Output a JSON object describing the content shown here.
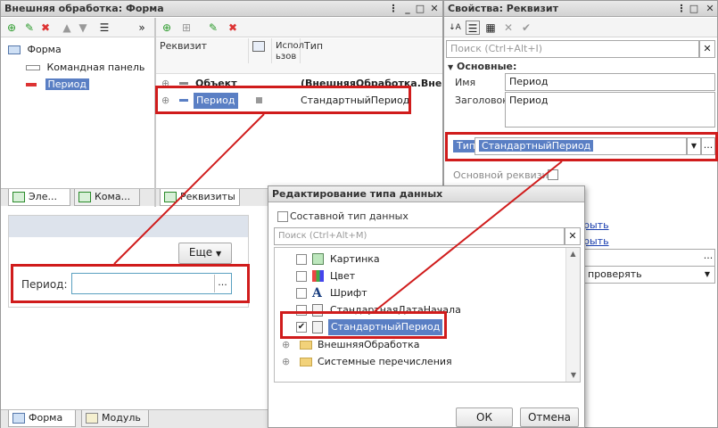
{
  "form_window": {
    "title": "Внешняя обработка: Форма",
    "tree": [
      "Форма",
      "Командная панель",
      "Период"
    ],
    "left_tabs": [
      "Эле...",
      "Кома..."
    ],
    "attr_headers": {
      "rekvizit": "Реквизит",
      "ispol": "Испол ьзов",
      "tip": "Тип"
    },
    "rows": [
      {
        "name": "Объект",
        "type": "(ВнешняяОбработка.Внеш"
      },
      {
        "name": "Период",
        "type": "СтандартныйПериод"
      }
    ],
    "right_tabs": [
      "Реквизиты"
    ],
    "preview_more": "Еще",
    "preview_field_label": "Период:",
    "preview_field_btn": "...",
    "bottom_tabs": [
      "Форма",
      "Модуль"
    ]
  },
  "props_window": {
    "title": "Свойства: Реквизит",
    "search_placeholder": "Поиск (Ctrl+Alt+I)",
    "section": "Основные:",
    "name_label": "Имя",
    "name_value": "Период",
    "header_label": "Заголовок",
    "header_value": "Период",
    "type_label": "Тип",
    "type_value": "СтандартныйПериод",
    "type_btn": "...",
    "main_attr_label": "Основной реквизит",
    "link1": "рыть",
    "link2": "рыть",
    "check_text": "проверять"
  },
  "type_dialog": {
    "title": "Редактирование типа данных",
    "composite_label": "Составной тип данных",
    "search_placeholder": "Поиск (Ctrl+Alt+M)",
    "items": [
      {
        "label": "Картинка",
        "checked": false
      },
      {
        "label": "Цвет",
        "checked": false
      },
      {
        "label": "Шрифт",
        "checked": false
      },
      {
        "label": "СтандартнаяДатаНачала",
        "checked": false
      },
      {
        "label": "СтандартныйПериод",
        "checked": true
      }
    ],
    "groups": [
      "ВнешняяОбработка",
      "Системные перечисления"
    ],
    "ok_label": "ОК",
    "cancel_label": "Отмена"
  }
}
